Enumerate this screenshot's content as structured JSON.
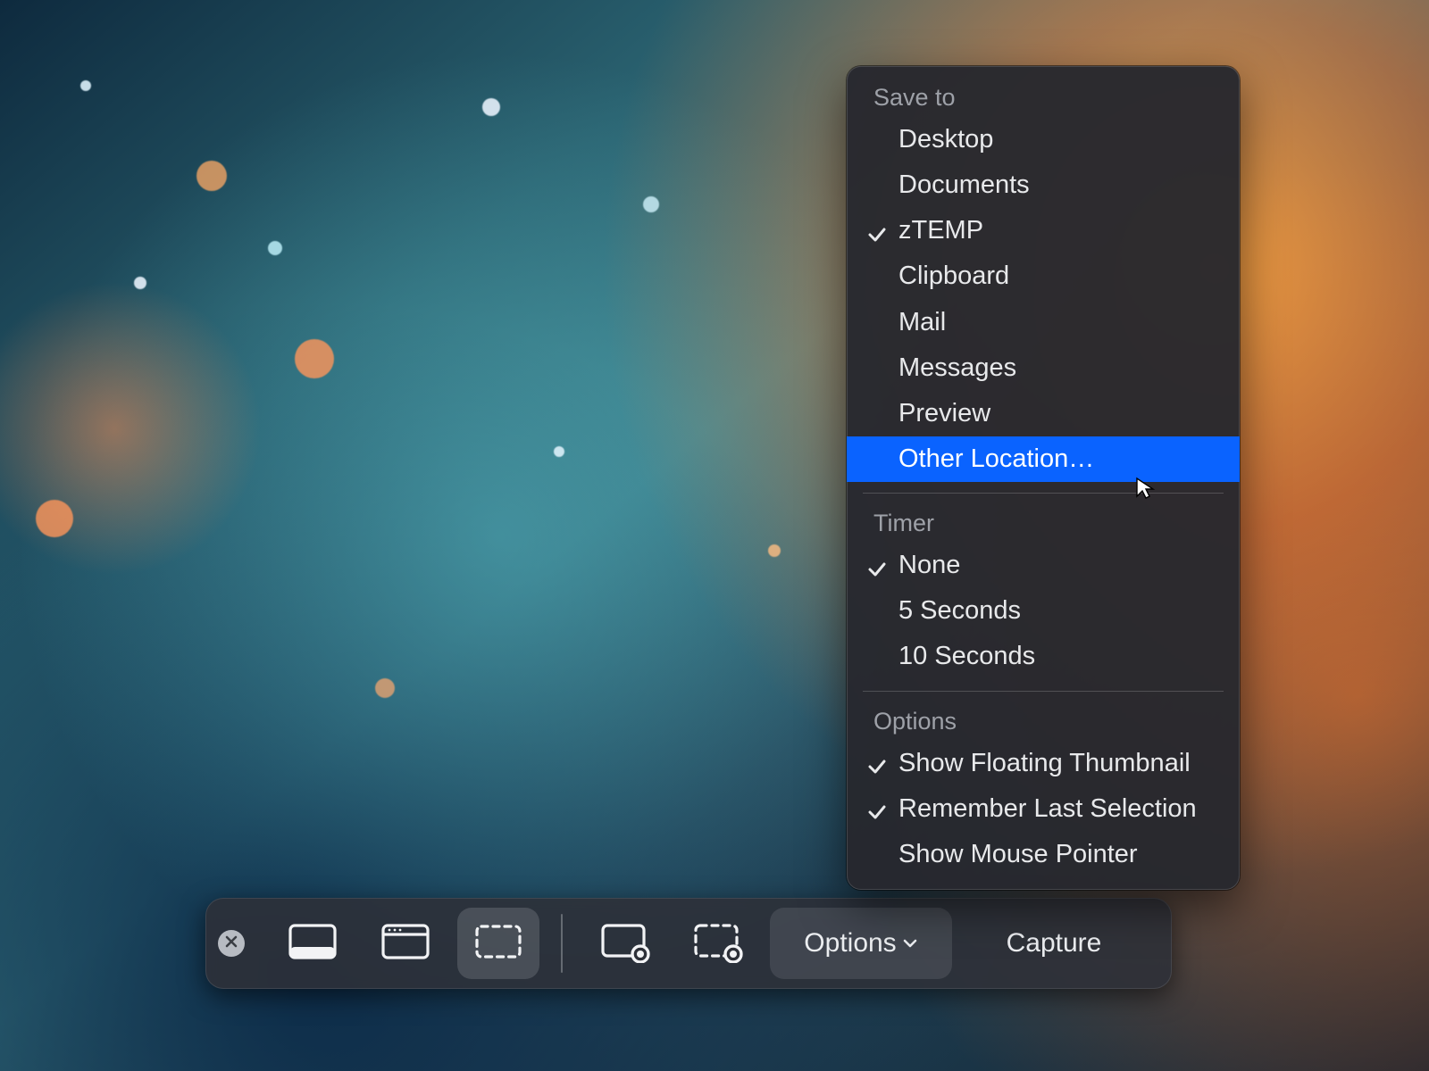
{
  "toolbar": {
    "options_label": "Options",
    "capture_label": "Capture"
  },
  "menu": {
    "sections": [
      {
        "header": "Save to",
        "items": [
          {
            "label": "Desktop",
            "checked": false,
            "hover": false
          },
          {
            "label": "Documents",
            "checked": false,
            "hover": false
          },
          {
            "label": "zTEMP",
            "checked": true,
            "hover": false
          },
          {
            "label": "Clipboard",
            "checked": false,
            "hover": false
          },
          {
            "label": "Mail",
            "checked": false,
            "hover": false
          },
          {
            "label": "Messages",
            "checked": false,
            "hover": false
          },
          {
            "label": "Preview",
            "checked": false,
            "hover": false
          },
          {
            "label": "Other Location…",
            "checked": false,
            "hover": true
          }
        ]
      },
      {
        "header": "Timer",
        "items": [
          {
            "label": "None",
            "checked": true,
            "hover": false
          },
          {
            "label": "5 Seconds",
            "checked": false,
            "hover": false
          },
          {
            "label": "10 Seconds",
            "checked": false,
            "hover": false
          }
        ]
      },
      {
        "header": "Options",
        "items": [
          {
            "label": "Show Floating Thumbnail",
            "checked": true,
            "hover": false
          },
          {
            "label": "Remember Last Selection",
            "checked": true,
            "hover": false
          },
          {
            "label": "Show Mouse Pointer",
            "checked": false,
            "hover": false
          }
        ]
      }
    ]
  }
}
